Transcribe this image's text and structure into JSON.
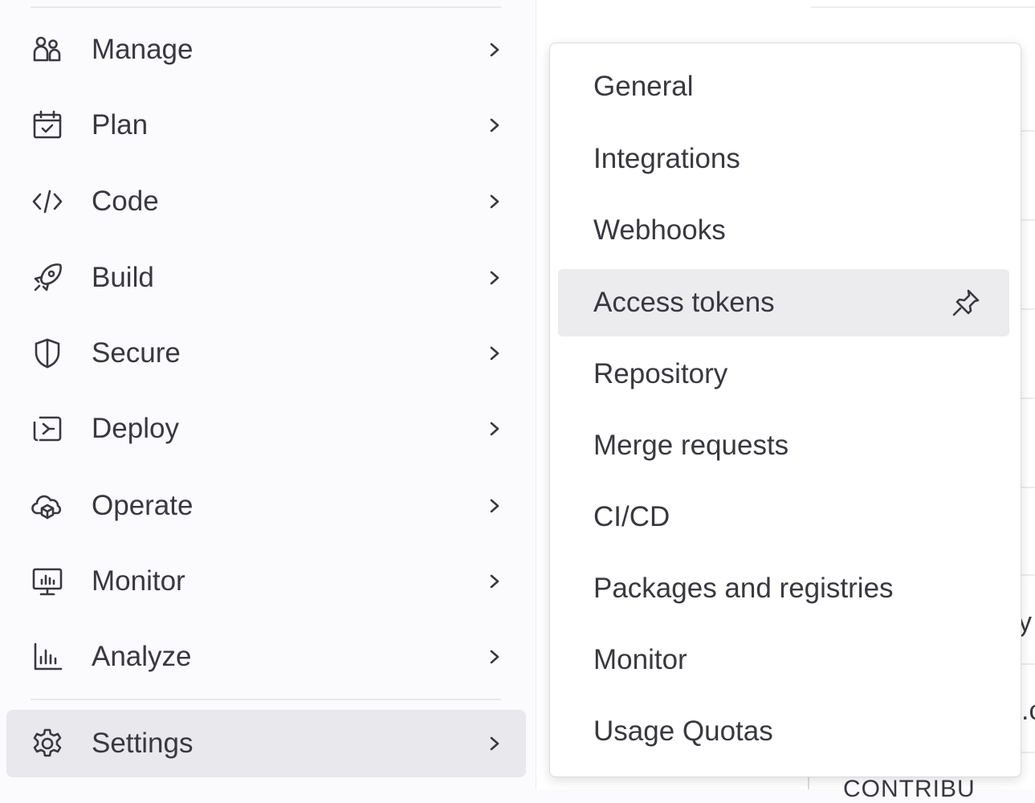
{
  "sidebar": {
    "items": [
      {
        "label": "Manage",
        "icon": "users-icon"
      },
      {
        "label": "Plan",
        "icon": "calendar-icon"
      },
      {
        "label": "Code",
        "icon": "code-icon"
      },
      {
        "label": "Build",
        "icon": "rocket-icon"
      },
      {
        "label": "Secure",
        "icon": "shield-icon"
      },
      {
        "label": "Deploy",
        "icon": "deploy-icon"
      },
      {
        "label": "Operate",
        "icon": "cloud-icon"
      },
      {
        "label": "Monitor",
        "icon": "monitor-icon"
      },
      {
        "label": "Analyze",
        "icon": "chart-icon"
      }
    ],
    "settings": {
      "label": "Settings",
      "icon": "gear-icon",
      "active": true
    }
  },
  "flyout": {
    "items": [
      {
        "label": "General"
      },
      {
        "label": "Integrations"
      },
      {
        "label": "Webhooks"
      },
      {
        "label": "Access tokens",
        "active": true,
        "pin_icon": "pin-icon"
      },
      {
        "label": "Repository"
      },
      {
        "label": "Merge requests"
      },
      {
        "label": "CI/CD"
      },
      {
        "label": "Packages and registries"
      },
      {
        "label": "Monitor"
      },
      {
        "label": "Usage Quotas"
      }
    ]
  },
  "background": {
    "fragment_1": "y",
    "fragment_2": ".c",
    "fragment_3": "CONTRIBU"
  },
  "colors": {
    "sidebar_bg": "#fbfafd",
    "active_bg": "#e9e8ec",
    "text": "#3a383f",
    "flyout_border": "#dcdcde"
  }
}
